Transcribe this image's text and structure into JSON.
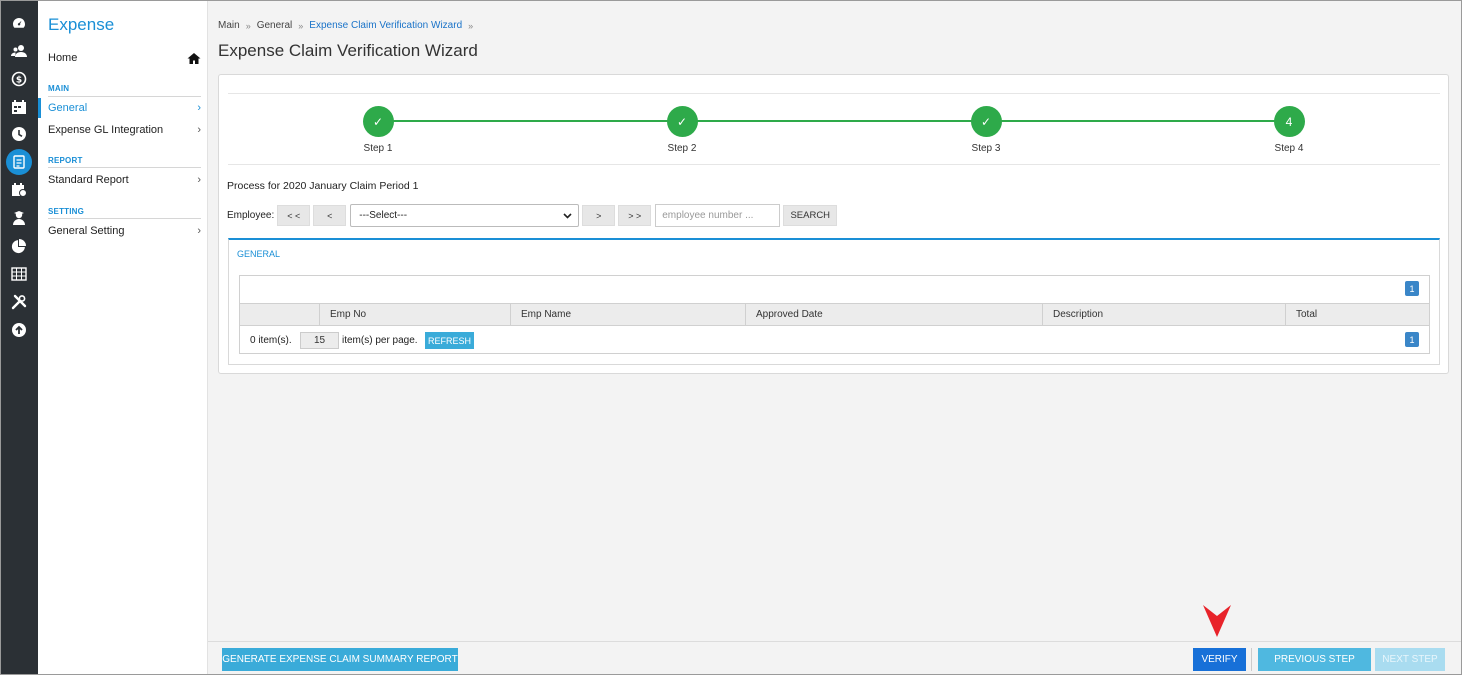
{
  "app": {
    "title": "Expense"
  },
  "sidebar": {
    "home_label": "Home",
    "sections": [
      {
        "label": "MAIN",
        "items": [
          {
            "label": "General",
            "active": true
          },
          {
            "label": "Expense GL Integration",
            "active": false
          }
        ]
      },
      {
        "label": "REPORT",
        "items": [
          {
            "label": "Standard Report",
            "active": false
          }
        ]
      },
      {
        "label": "SETTING",
        "items": [
          {
            "label": "General Setting",
            "active": false
          }
        ]
      }
    ],
    "chevron": "›"
  },
  "rail_icons": [
    "dashboard-icon",
    "users-icon",
    "payroll-icon",
    "calendar-icon",
    "clock-icon",
    "expense-icon",
    "schedule-icon",
    "training-icon",
    "chart-pie-icon",
    "table-icon",
    "tools-icon",
    "upload-icon"
  ],
  "breadcrumb": {
    "items": [
      "Main",
      "General",
      "Expense Claim Verification Wizard"
    ],
    "sep": "»"
  },
  "page": {
    "title": "Expense Claim Verification Wizard"
  },
  "wizard": {
    "steps": [
      {
        "label": "Step 1",
        "status": "done",
        "marker": "✓"
      },
      {
        "label": "Step 2",
        "status": "done",
        "marker": "✓"
      },
      {
        "label": "Step 3",
        "status": "done",
        "marker": "✓"
      },
      {
        "label": "Step 4",
        "status": "current",
        "marker": "4"
      }
    ]
  },
  "process_text": "Process for 2020 January Claim Period 1",
  "employee_nav": {
    "label": "Employee:",
    "first": "< <",
    "prev": "<",
    "select_value": "---Select---",
    "next": ">",
    "last": "> >",
    "search_placeholder": "employee number ...",
    "search_button": "SEARCH"
  },
  "general_panel": {
    "title": "GENERAL",
    "columns": [
      "",
      "Emp No",
      "Emp Name",
      "Approved Date",
      "Description",
      "Total"
    ],
    "rows": [],
    "page_current": "1",
    "items_count_text": "0 item(s).",
    "page_size": "15",
    "per_page_text": "item(s) per page.",
    "refresh_label": "REFRESH"
  },
  "footer": {
    "generate_label": "GENERATE EXPENSE CLAIM SUMMARY REPORT",
    "verify_label": "VERIFY",
    "previous_label": "PREVIOUS STEP",
    "next_label": "NEXT STEP"
  },
  "colors": {
    "accent": "#1a8fd6",
    "step_done": "#2eaa4a",
    "verify": "#1770d8",
    "marker": "#e8232a"
  }
}
